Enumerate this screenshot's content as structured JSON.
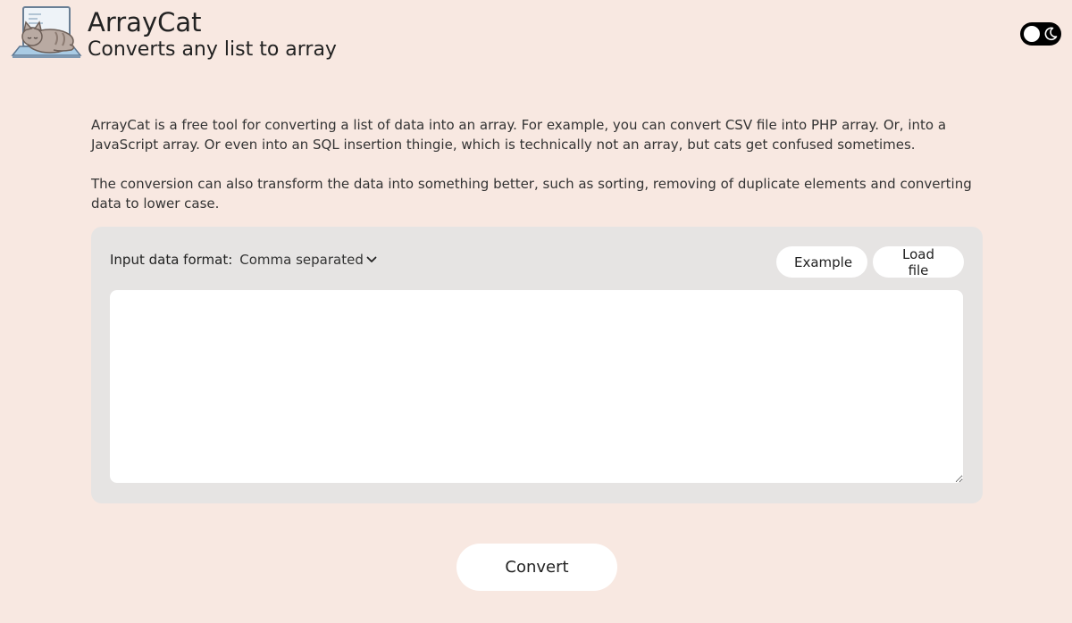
{
  "header": {
    "title": "ArrayCat",
    "subtitle": "Converts any list to array",
    "logo_icon": "cat-on-laptop-icon"
  },
  "theme_toggle": {
    "icon": "moon-icon",
    "state": "light"
  },
  "intro": {
    "paragraph1": "ArrayCat is a free tool for converting a list of data into an array. For example, you can convert CSV file into PHP array. Or, into a JavaScript array. Or even into an SQL insertion thingie, which is technically not an array, but cats get confused sometimes.",
    "paragraph2": "The conversion can also transform the data into something better, such as sorting, removing of duplicate elements and converting data to lower case."
  },
  "panel": {
    "format_label": "Input data format:",
    "format_value": "Comma separated",
    "example_label": "Example",
    "load_file_label": "Load file",
    "input_value": "",
    "input_placeholder": ""
  },
  "convert_label": "Convert",
  "colors": {
    "page_background": "#f8e8e1",
    "panel_background": "#e6e4e3",
    "toggle_background": "#000000"
  }
}
